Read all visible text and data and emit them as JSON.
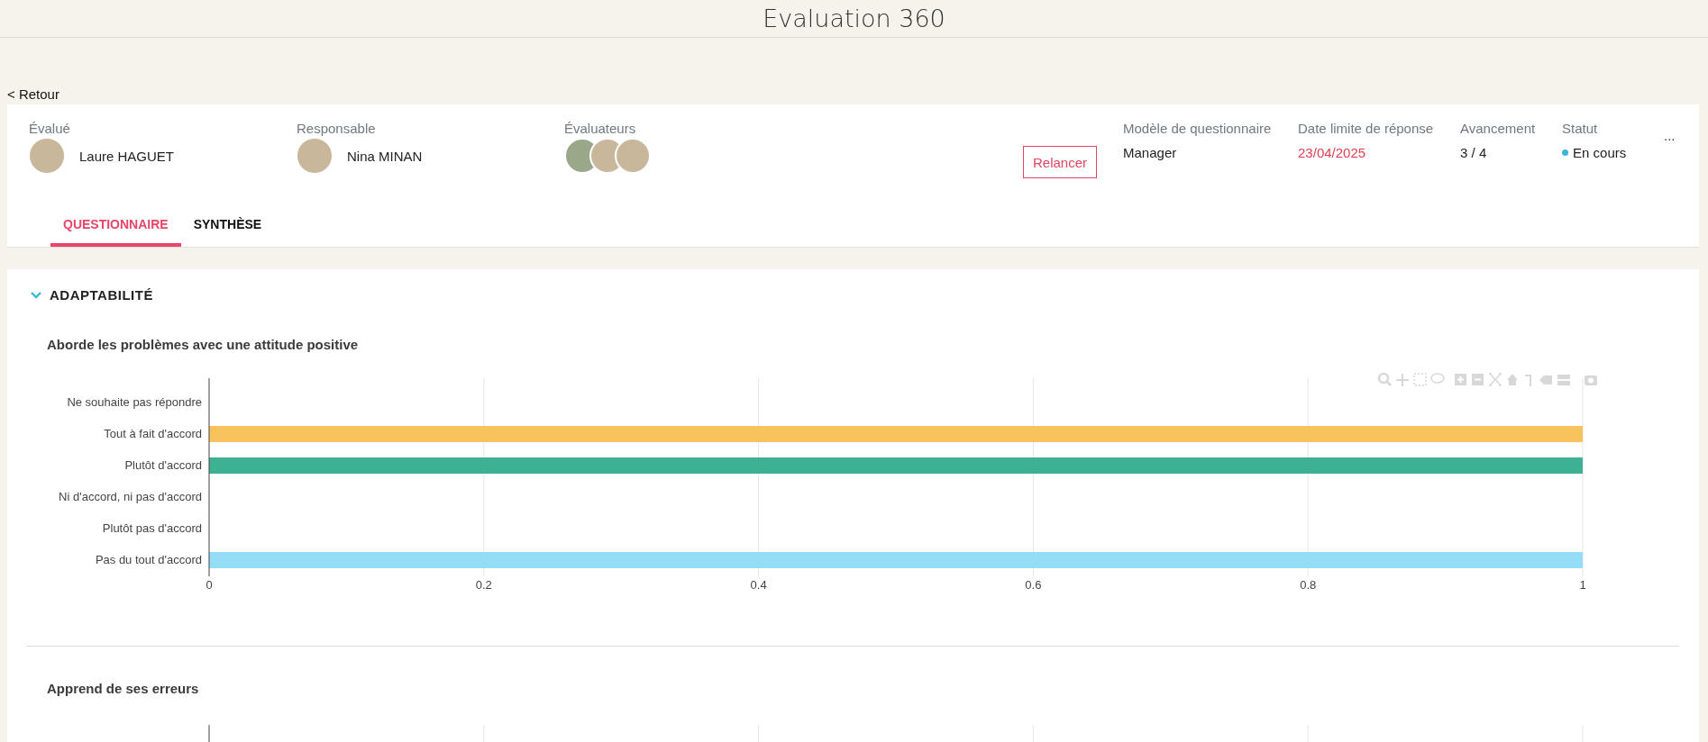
{
  "header": {
    "title": "Evaluation 360"
  },
  "back_link": "< Retour",
  "summary": {
    "evaluated": {
      "label": "Évalué",
      "name": "Laure HAGUET"
    },
    "manager": {
      "label": "Responsable",
      "name": "Nina MINAN"
    },
    "evaluators": {
      "label": "Évaluateurs",
      "avatars": [
        {
          "kind": "photo"
        },
        {
          "kind": "photo"
        },
        {
          "kind": "photo"
        }
      ]
    },
    "remind_button": "Relancer",
    "fields": [
      {
        "label": "Modèle de questionnaire",
        "value": "Manager",
        "kind": "text"
      },
      {
        "label": "Date limite de réponse",
        "value": "23/04/2025",
        "kind": "deadline"
      },
      {
        "label": "Avancement",
        "value": "3 / 4",
        "kind": "text"
      },
      {
        "label": "Statut",
        "value": "En cours",
        "kind": "status",
        "color": "#3bb5d6"
      }
    ],
    "more_button": "..."
  },
  "tabs": [
    {
      "label": "QUESTIONNAIRE",
      "selected": true
    },
    {
      "label": "SYNTHÈSE",
      "selected": false
    }
  ],
  "section": {
    "title": "ADAPTABILITÉ",
    "expanded": true,
    "questions": [
      {
        "title": "Aborde les problèmes avec une attitude positive",
        "chart_data": {
          "type": "bar",
          "orientation": "horizontal",
          "categories": [
            "Ne souhaite pas répondre",
            "Tout à fait d'accord",
            "Plutôt d'accord",
            "Ni d'accord, ni pas d'accord",
            "Plutôt pas d'accord",
            "Pas du tout d'accord"
          ],
          "values": [
            0,
            1,
            1,
            0,
            0,
            1
          ],
          "grid": true,
          "colors": [
            "#9e9e9e",
            "#f8c25c",
            "#3eb193",
            "#b9b9b9",
            "#e6e6e6",
            "#95dcf7"
          ],
          "xlim": [
            0,
            1
          ],
          "xticks": [
            {
              "value": 0,
              "label": "0"
            },
            {
              "value": 0.2,
              "label": "0.2"
            },
            {
              "value": 0.4,
              "label": "0.4"
            },
            {
              "value": 0.6,
              "label": "0.6"
            },
            {
              "value": 0.8,
              "label": "0.8"
            },
            {
              "value": 1,
              "label": "1"
            }
          ]
        }
      },
      {
        "title": "Apprend de ses erreurs"
      }
    ]
  }
}
